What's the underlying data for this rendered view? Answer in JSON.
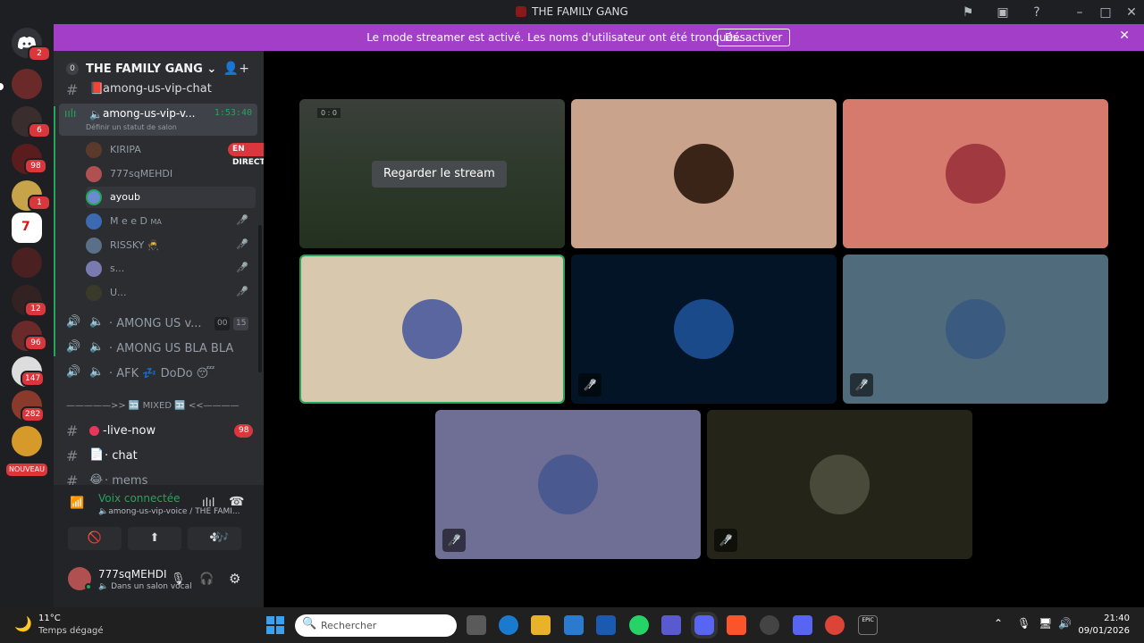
{
  "window": {
    "title": "THE FAMILY GANG"
  },
  "serverbar": {
    "home_badge": "2",
    "badges": [
      "6",
      "98",
      "1",
      "12",
      "96",
      "147",
      "282"
    ],
    "new_label": "NOUVEAU"
  },
  "banner": {
    "message": "Le mode streamer est activé. Les noms d'utilisateur ont été tronqués.",
    "button": "Désactiver"
  },
  "guild": {
    "name": "THE FAMILY GANG",
    "boost_count": "0"
  },
  "channels": {
    "top_text": "among-us-vip-chat",
    "active_voice": {
      "name": "among-us-vip-v...",
      "timer": "1:53:40",
      "status_placeholder": "Définir un statut de salon"
    },
    "members": [
      {
        "name": "KIRIPA",
        "live": "EN DIRECT"
      },
      {
        "name": "777sqMEHDI"
      },
      {
        "name": "ayoub"
      },
      {
        "name": "M e e D",
        "tag": "MA"
      },
      {
        "name": "RISSKY",
        "emoji": "🥷"
      },
      {
        "name": "s..."
      },
      {
        "name": "U..."
      }
    ],
    "voice_channels": [
      {
        "name": "AMONG US v...",
        "count_a": "00",
        "count_b": "15"
      },
      {
        "name": "AMONG US BLA BLA"
      },
      {
        "name": "AFK 💤 DoDo 😴"
      }
    ],
    "category": "—————>> 🈁 MIXED 🈁 <<————",
    "text_channels": [
      {
        "name": "-live-now",
        "badge": "98"
      },
      {
        "name": "chat"
      },
      {
        "name": "mems"
      }
    ]
  },
  "voice_panel": {
    "status": "Voix connectée",
    "location": "among-us-vip-voice / THE FAMI..."
  },
  "user": {
    "name": "777sqMEHDI",
    "status": "Dans un salon vocal"
  },
  "stage": {
    "watch_label": "Regarder le stream",
    "scoreboard": "0 : 0"
  },
  "taskbar": {
    "weather_temp": "11°C",
    "weather_desc": "Temps dégagé",
    "search_placeholder": "Rechercher",
    "time": "21:40",
    "date": "09/01/2026"
  },
  "colors": {
    "banner": "#a23ec8",
    "tile1": "#c9a38b",
    "tile2": "#d77a6e",
    "tile3": "#d7c8ae",
    "tile4": "#041427",
    "tile5": "#4f6b7c",
    "tile6": "#6f6e95",
    "tile7": "#242419"
  }
}
